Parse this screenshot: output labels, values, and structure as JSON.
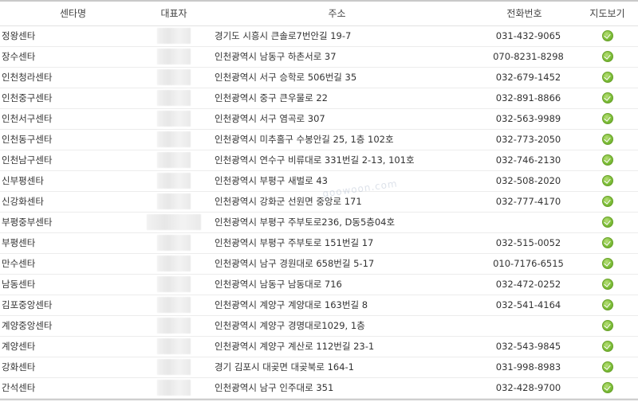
{
  "table": {
    "headers": [
      "센타명",
      "대표자",
      "주소",
      "전화번호",
      "지도보기"
    ],
    "rows": [
      {
        "name": "정왕센타",
        "address": "경기도 시흥시 큰솔로7번안길 19-7",
        "phone": "031-432-9065"
      },
      {
        "name": "장수센타",
        "address": "인천광역시 남동구 하촌서로 37",
        "phone": "070-8231-8298"
      },
      {
        "name": "인천청라센타",
        "address": "인천광역시 서구 승학로 506번길 35",
        "phone": "032-679-1452"
      },
      {
        "name": "인천중구센타",
        "address": "인천광역시 중구 큰우물로 22",
        "phone": "032-891-8866"
      },
      {
        "name": "인천서구센타",
        "address": "인천광역시 서구 염곡로 307",
        "phone": "032-563-9989"
      },
      {
        "name": "인천동구센타",
        "address": "인천광역시 미추홀구 수봉안길 25, 1층 102호",
        "phone": "032-773-2050"
      },
      {
        "name": "인천남구센타",
        "address": "인천광역시 연수구 비류대로 331번길 2-13, 101호",
        "phone": "032-746-2130"
      },
      {
        "name": "신부평센타",
        "address": "인천광역시 부평구 새벌로 43",
        "phone": "032-508-2020"
      },
      {
        "name": "신강화센타",
        "address": "인천광역시 강화군 선원면 중앙로 171",
        "phone": "032-777-4170"
      },
      {
        "name": "부평중부센타",
        "address": "인천광역시 부평구 주부토로236, D동5층04호",
        "phone": ""
      },
      {
        "name": "부평센타",
        "address": "인천광역시 부평구 주부토로 151번길 17",
        "phone": "032-515-0052"
      },
      {
        "name": "만수센타",
        "address": "인천광역시 남구 경원대로 658번길 5-17",
        "phone": "010-7176-6515"
      },
      {
        "name": "남동센타",
        "address": "인천광역시 남동구 남동대로 716",
        "phone": "032-472-0252"
      },
      {
        "name": "김포중앙센타",
        "address": "인천광역시 계양구 계양대로 163번길 8",
        "phone": "032-541-4164"
      },
      {
        "name": "계양중앙센타",
        "address": "인천광역시 계양구 경명대로1029, 1층",
        "phone": ""
      },
      {
        "name": "계양센타",
        "address": "인천광역시 계양구 계산로 112번길 23-1",
        "phone": "032-543-9845"
      },
      {
        "name": "강화센타",
        "address": "경기 김포시 대곶면 대곶북로 164-1",
        "phone": "031-998-8983"
      },
      {
        "name": "간석센타",
        "address": "인천광역시 남구 인주대로 351",
        "phone": "032-428-9700"
      }
    ]
  },
  "watermark": "goowoon.com",
  "icons": {
    "map": "map-pin-icon"
  },
  "colors": {
    "map_icon": "#7fbf3a"
  }
}
